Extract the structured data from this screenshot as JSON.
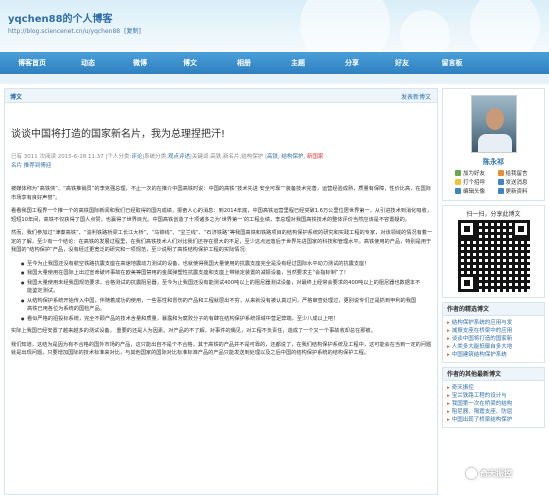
{
  "blog": {
    "title": "yqchen88的个人博客",
    "url": "http://blog.sciencenet.cn/u/yqchen88",
    "copy_label": "[复制]"
  },
  "nav": [
    "博客首页",
    "动态",
    "微博",
    "博文",
    "相册",
    "主题",
    "分享",
    "好友",
    "留言板"
  ],
  "main": {
    "header_label": "博文",
    "newest_link": "发表新博文",
    "post_title": "谈谈中国将打造的国家新名片，我为总理捏把汗!",
    "meta_line1_prefix": "已有 3011 次阅读 2015-6-28 11:37 |个人分类:",
    "meta_category": "评论",
    "meta_system": "|系统分类:",
    "meta_system_val": "观点评述",
    "meta_keywords": "|关键词:高铁,新名片,结构保护 |",
    "meta_tags": "高铁, 结构保护,",
    "meta_new": "新",
    "meta_new2": "国家",
    "meta_line2_link1": "名片",
    "meta_line2_link2": "推荐到博迎",
    "paragraphs": [
      "被媒体称为“高铁侠”、“高铁推销员”的李克强总理，不止一次的在推介中国高铁时说：中国的高铁“技术先进 安全可靠”“装备技术完善，运营经验成熟，质量有保障，性价比高，在国际市场享有良好声誉”。",
      "看看我国工程界一个推一个的高铁国际新闻和我们已经取得的国内成绩，振奋人心的消息：到2014年底，中国高铁运营里程已经突破1.6万公里位居世界第一，从引进技术到消化吸收，短短10年间，高铁不仅获得了国人点赞，也赢得了世界目光。中国高铁创造了十项诸多之为‘世界第一’的工程业绩，李总理对我国高铁技术的整体评价当然应该是不容置疑的。",
      "然而，我们参加过“津秦高铁”、“渝利铁路桥梁工长江大桥”、“乌锦线”、“宝兰线”、“石济铁路”等我国高铁和铁路项目的结构保护系统的研究和实践工程的专家，对该领域的情况有着一定的了解，至少有一个结论：在高铁的发展过程里，在我们高铁技术人们对比我们还存在很大的不足，至少这点远落后于世界先进国家的科技和管理水平。高铁使用的产品，特别是用于我国的“结构保护”产品，没有经过更宽泛的研究和一项规范，至少说明了高铁结构保护工程的实际情况："
    ],
    "bullets": [
      "至今为止我国还没有航空铁路抗震支座在高速地震动力测试的设备，也就使得我国大量使用的抗震支座完全是没有经过国际水平动力测试的抗震支座！",
      "我国大量使用在国际上出过宣命破坏事故在欧美等国禁用的金属弹塑性抗震支座和支座上带锁定装置的减振设备，当然要求主“会指标制”了！",
      "我国大量使用未经我国规范要求，合格测试的抗震阻尼器，至今为止我国还没有能测试400吨以上的阻尼器测试设备，对最终上经常会要求的400吨以上的阻尼器也数据本不能鉴定测试。",
      "从结构保护系统开始传入中国，伴随着成功的使用，一些恶性和冒伤的产品和工程就层出不穷，从来就没有被认真过问，严格审查处理过，更别说专们正是抓到甲利的我国高铁已用各位为系统的国检产品。",
      "看似严格的招投标系统，完全不顾产品的技术含量和质量，暴露和为腐败分子的有肆在结构保护系统领域中营足弊端，至少八成以上吧！"
    ],
    "closing": [
      "实际上我国已经安置了越来越多的测试设备。 重要的还是人为因素。对产品的不了解，对事件的偶见，对工程不负责任，造成了一个又一个事故收却总在那被。",
      "我们知道，这结为是因为有不合格的国外市场的产品，这只能出自不是个不合格，其于高铁的产品并不是可靠的，还都说了，在我们结构保护系统及工程中，这可能会在当到一定的问题就是出现问题，只要增加国际的技术标准来对比，与其他国家的国际对比标准标准产品的产品只能发送到处理以及之后中国的结构保护系统的结构保护工程。"
    ]
  },
  "sidebar": {
    "author": "陈永祁",
    "actions": [
      "加为好友",
      "给我留言",
      "打个招呼",
      "发送消息",
      "编辑头像",
      "更新资料"
    ],
    "scan_label": "扫一扫，分享此博文",
    "recent_head": "作者的精选博文",
    "recent": [
      "结构保护系统的应用与发",
      "减振支座在桥梁中的应用",
      "谈谈中国将打造的国家新",
      "人类多大能抵御自多大地",
      "中国建筑结构保护系统"
    ],
    "other_head": "作者的其他最新博文",
    "other": [
      "奇天振控",
      "宝兰铁路工程的设计与",
      "我国第一次在桥梁的结构",
      "阻尼器、隔震支座、防屈",
      "中国出现了桥梁结构保护"
    ]
  },
  "watermark": "奇天振控"
}
